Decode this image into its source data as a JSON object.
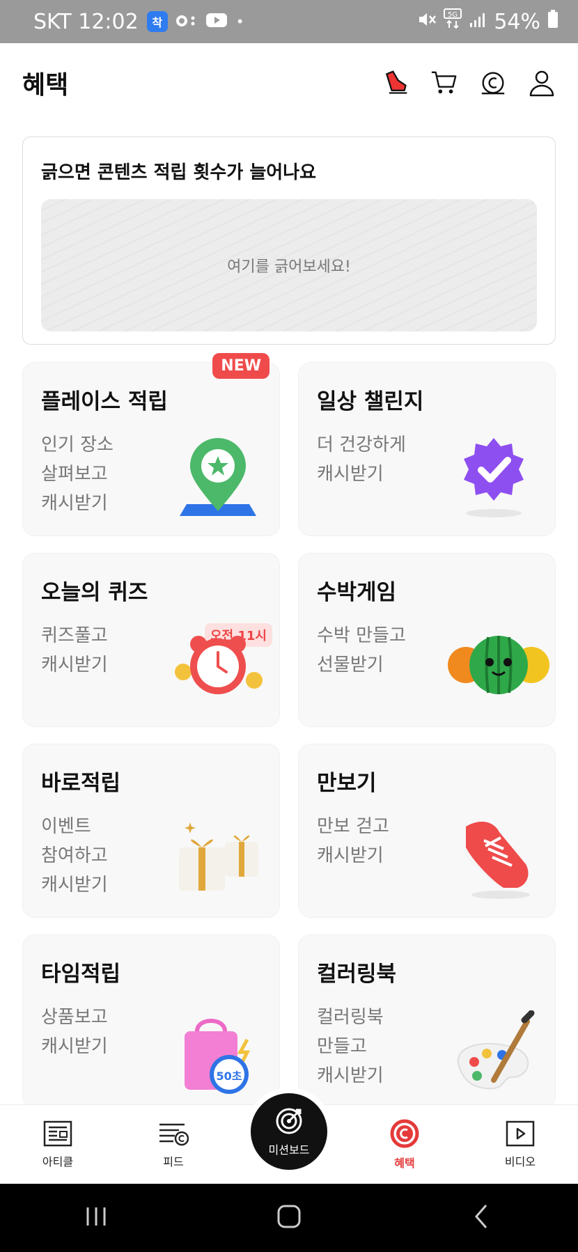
{
  "status_bar": {
    "carrier_time": "SKT 12:02",
    "app_badge": "착",
    "dot": "•",
    "battery": "54%"
  },
  "header": {
    "title": "혜택"
  },
  "scratch": {
    "title": "긁으면 콘텐츠 적립 횟수가 늘어나요",
    "hint": "여기를 긁어보세요!"
  },
  "cards": [
    {
      "title": "플레이스 적립",
      "lines": [
        "인기 장소",
        "살펴보고",
        "캐시받기"
      ],
      "badge": "NEW",
      "icon": "map-pin-star-icon"
    },
    {
      "title": "일상 챌린지",
      "lines": [
        "더 건강하게",
        "캐시받기"
      ],
      "icon": "verified-badge-icon"
    },
    {
      "title": "오늘의 퀴즈",
      "lines": [
        "퀴즈풀고",
        "캐시받기"
      ],
      "badge": "오전 11시",
      "icon": "alarm-clock-icon"
    },
    {
      "title": "수박게임",
      "lines": [
        "수박 만들고",
        "선물받기"
      ],
      "icon": "watermelon-icon"
    },
    {
      "title": "바로적립",
      "lines": [
        "이벤트",
        "참여하고",
        "캐시받기"
      ],
      "icon": "gift-box-icon"
    },
    {
      "title": "만보기",
      "lines": [
        "만보 걷고",
        "캐시받기"
      ],
      "icon": "sneaker-icon"
    },
    {
      "title": "타임적립",
      "lines": [
        "상품보고",
        "캐시받기"
      ],
      "badge": "50초",
      "icon": "shopping-bag-timer-icon"
    },
    {
      "title": "컬러링북",
      "lines": [
        "컬러링북",
        "만들고",
        "캐시받기"
      ],
      "icon": "paint-palette-icon"
    }
  ],
  "bottom_nav": {
    "article": "아티클",
    "feed": "피드",
    "mission": "미션보드",
    "benefit": "혜택",
    "video": "비디오"
  },
  "colors": {
    "accent": "#e43a3a",
    "card_bg": "#f8f8f8",
    "new_badge": "#ef4b4b"
  }
}
